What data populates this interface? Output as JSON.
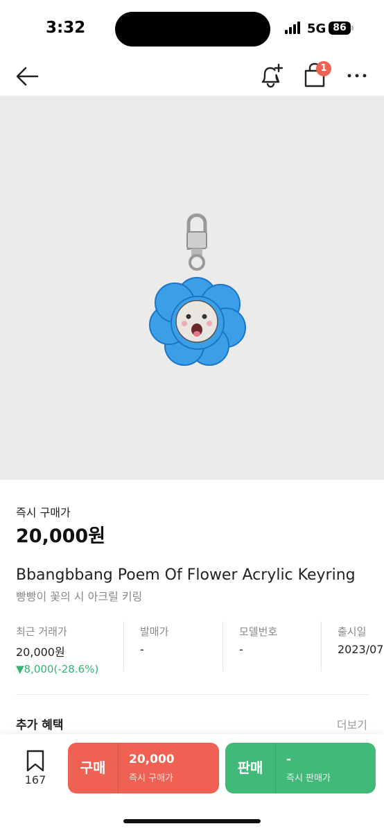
{
  "status_bar": {
    "time": "3:32",
    "network": "5G",
    "battery": "86"
  },
  "nav": {
    "back_icon": "arrow-left-icon",
    "alert_icon": "bell-plus-icon",
    "bag_icon": "shopping-bag-icon",
    "bag_badge": "1",
    "more_icon": "more-horizontal-icon"
  },
  "product": {
    "price_label": "즉시 구매가",
    "price_value": "20,000원",
    "title_en": "Bbangbbang Poem Of Flower Acrylic Keyring",
    "title_ko": "빵빵이 꽃의 시 아크릴 키링",
    "image_icon": "flower-keyring-image"
  },
  "info": [
    {
      "label": "최근 거래가",
      "value": "20,000원",
      "change": "▼8,000(-28.6%)"
    },
    {
      "label": "발매가",
      "value": "-"
    },
    {
      "label": "모델번호",
      "value": "-"
    },
    {
      "label": "출시일",
      "value": "2023/07"
    }
  ],
  "extra": {
    "title": "추가 혜택",
    "more": "더보기"
  },
  "bottom": {
    "wish_count": "167",
    "buy": {
      "kind": "구매",
      "amount": "20,000",
      "sub": "즉시 구매가"
    },
    "sell": {
      "kind": "판매",
      "amount": "-",
      "sub": "즉시 판매가"
    }
  },
  "colors": {
    "buy": "#ef6253",
    "sell": "#41b979",
    "price_down": "#31b46e",
    "flower": "#3b9fe8"
  }
}
